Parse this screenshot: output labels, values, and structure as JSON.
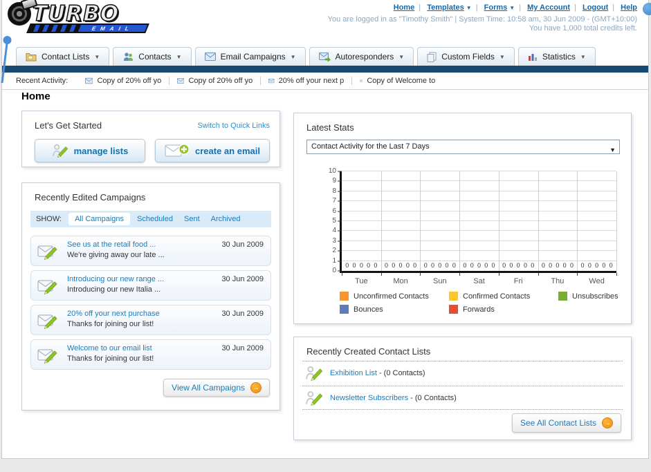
{
  "header": {
    "logo_title": "TURBO",
    "logo_subtitle": "EMAIL",
    "links": [
      "Home",
      "Templates",
      "Forms",
      "My Account",
      "Logout",
      "Help"
    ],
    "status_line": "You are logged in as \"Timothy Smith\" | System Time: 10:58 am, 30 Jun 2009 - (GMT+10:00)",
    "credits_line": "You have 1,000 total credits left."
  },
  "nav_tabs": [
    {
      "label": "Contact Lists"
    },
    {
      "label": "Contacts"
    },
    {
      "label": "Email Campaigns"
    },
    {
      "label": "Autoresponders"
    },
    {
      "label": "Custom Fields"
    },
    {
      "label": "Statistics"
    }
  ],
  "recent_activity": {
    "label": "Recent Activity:",
    "items": [
      "Copy of 20% off yo",
      "Copy of 20% off yo",
      "20% off your next p",
      "Copy of Welcome to"
    ]
  },
  "page_title": "Home",
  "get_started": {
    "title": "Let's Get Started",
    "switch_link": "Switch to Quick Links",
    "manage_button": "manage lists",
    "create_button": "create an email"
  },
  "campaigns": {
    "title": "Recently Edited Campaigns",
    "show_label": "SHOW:",
    "filters": [
      "All Campaigns",
      "Scheduled",
      "Sent",
      "Archived"
    ],
    "active_filter": "All Campaigns",
    "items": [
      {
        "title": "See us at the retail food ...",
        "subtitle": "We're giving away our late ...",
        "date": "30 Jun 2009"
      },
      {
        "title": "Introducing our new range ...",
        "subtitle": "Introducing our new Italia ...",
        "date": "30 Jun 2009"
      },
      {
        "title": "20% off your next purchase",
        "subtitle": "Thanks for joining our list!",
        "date": "30 Jun 2009"
      },
      {
        "title": "Welcome to our email list",
        "subtitle": "Thanks for joining our list!",
        "date": "30 Jun 2009"
      }
    ],
    "view_all_button": "View All Campaigns"
  },
  "stats": {
    "title": "Latest Stats",
    "period_selector": "Contact Activity for the Last 7 Days"
  },
  "chart_data": {
    "type": "bar",
    "title": "Contact Activity for the Last 7 Days",
    "categories": [
      "Tue",
      "Mon",
      "Sun",
      "Sat",
      "Fri",
      "Thu",
      "Wed"
    ],
    "series": [
      {
        "name": "Unconfirmed Contacts",
        "color": "#f6942d",
        "values": [
          0,
          0,
          0,
          0,
          0,
          0,
          0
        ]
      },
      {
        "name": "Confirmed Contacts",
        "color": "#fcc72d",
        "values": [
          0,
          0,
          0,
          0,
          0,
          0,
          0
        ]
      },
      {
        "name": "Unsubscribes",
        "color": "#79ac30",
        "values": [
          0,
          0,
          0,
          0,
          0,
          0,
          0
        ]
      },
      {
        "name": "Bounces",
        "color": "#5f7cb8",
        "values": [
          0,
          0,
          0,
          0,
          0,
          0,
          0
        ]
      },
      {
        "name": "Forwards",
        "color": "#e84e2d",
        "values": [
          0,
          0,
          0,
          0,
          0,
          0,
          0
        ]
      }
    ],
    "ylim": [
      0,
      10
    ],
    "yticks": [
      0,
      1,
      2,
      3,
      4,
      5,
      6,
      7,
      8,
      9,
      10
    ],
    "grid": true,
    "show_value_labels": true,
    "legend_position": "bottom"
  },
  "contact_lists": {
    "title": "Recently Created Contact Lists",
    "items": [
      {
        "name": "Exhibition List",
        "detail": "- (0 Contacts)"
      },
      {
        "name": "Newsletter Subscribers",
        "detail": "- (0 Contacts)"
      }
    ],
    "see_all_button": "See All Contact Lists"
  },
  "colors": {
    "accent_link": "#1b7cba",
    "navy_bar": "#1a4a71",
    "arrow_button_orange": "#f39a1a"
  }
}
